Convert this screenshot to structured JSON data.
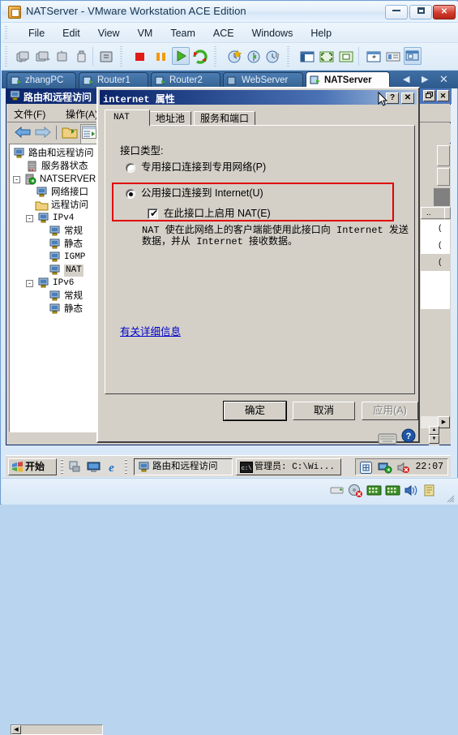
{
  "vmware": {
    "title": "NATServer - VMware Workstation ACE Edition",
    "window_buttons": {
      "minimize": "minimize-icon",
      "maximize": "maximize-icon",
      "close": "✕"
    },
    "menu": [
      "File",
      "Edit",
      "View",
      "VM",
      "Team",
      "ACE",
      "Windows",
      "Help"
    ],
    "toolbar_icons": [
      "power-on-snapshot-icon",
      "snapshot-manager-icon",
      "revert-snapshot-icon",
      "usb-device-icon",
      "summary-view-icon",
      "stop-icon",
      "pause-icon",
      "play-icon",
      "reset-icon",
      "take-snapshot-icon",
      "revert-icon",
      "manage-snapshots-icon",
      "show-sidebar-icon",
      "fullscreen-icon",
      "quick-switch-icon",
      "settings-icon",
      "console-view-icon",
      "multiple-monitors-icon"
    ],
    "tabs": [
      {
        "label": "zhangPC",
        "active": false
      },
      {
        "label": "Router1",
        "active": false
      },
      {
        "label": "Router2",
        "active": false
      },
      {
        "label": "WebServer",
        "active": false
      },
      {
        "label": "NATServer",
        "active": true
      }
    ],
    "tab_nav": {
      "prev": "◀",
      "next": "▶",
      "close": "✕"
    },
    "statusbar_icons": [
      "floppy-icon",
      "disk-icon",
      "network-icon-1",
      "network-icon-2",
      "sound-icon",
      "printer-icon"
    ]
  },
  "mmc": {
    "title": "路由和远程访问",
    "title_icon": "computer-icon",
    "window_buttons": [
      "restore-icon",
      "close-icon"
    ],
    "menu": [
      "文件(F)",
      "操作(A)"
    ],
    "toolbar_icons": [
      "back-arrow-icon",
      "forward-arrow-icon",
      "show-hide-console-tree-icon",
      "properties-icon"
    ],
    "tree": [
      {
        "label": "路由和远程访问",
        "indent": 0,
        "icon": "computer-icon",
        "expander": "",
        "selected": false
      },
      {
        "label": "服务器状态",
        "indent": 1,
        "icon": "server-icon",
        "expander": "",
        "selected": false
      },
      {
        "label": "NATSERVER",
        "indent": 1,
        "icon": "server-active-icon",
        "expander": "-",
        "selected": false
      },
      {
        "label": "网络接口",
        "indent": 2,
        "icon": "computer-icon",
        "expander": "",
        "selected": false
      },
      {
        "label": "远程访问",
        "indent": 2,
        "icon": "folder-icon",
        "expander": "",
        "selected": false
      },
      {
        "label": "IPv4",
        "indent": 2,
        "icon": "computer-icon",
        "expander": "-",
        "selected": false
      },
      {
        "label": "常规",
        "indent": 3,
        "icon": "computer-icon",
        "expander": "",
        "selected": false
      },
      {
        "label": "静态",
        "indent": 3,
        "icon": "computer-icon",
        "expander": "",
        "selected": false
      },
      {
        "label": "IGMP",
        "indent": 3,
        "icon": "computer-icon",
        "expander": "",
        "selected": false
      },
      {
        "label": "NAT",
        "indent": 3,
        "icon": "computer-icon",
        "expander": "",
        "selected": true
      },
      {
        "label": "IPv6",
        "indent": 2,
        "icon": "computer-icon",
        "expander": "-",
        "selected": false
      },
      {
        "label": "常规",
        "indent": 3,
        "icon": "computer-icon",
        "expander": "",
        "selected": false
      },
      {
        "label": "静态",
        "indent": 3,
        "icon": "computer-icon",
        "expander": "",
        "selected": false
      }
    ],
    "right_pane": {
      "column_header": "..",
      "rows": [
        "(",
        "(",
        "("
      ]
    }
  },
  "dialog": {
    "title": "internet 属性",
    "help_button": "?",
    "close_button": "✕",
    "tabs": [
      {
        "label": "NAT",
        "active": true
      },
      {
        "label": "地址池",
        "active": false
      },
      {
        "label": "服务和端口",
        "active": false
      }
    ],
    "interface_type_label": "接口类型:",
    "radio_private": {
      "label": "专用接口连接到专用网络(P)",
      "checked": false
    },
    "radio_public": {
      "label": "公用接口连接到 Internet(U)",
      "checked": true
    },
    "checkbox_nat": {
      "label": "在此接口上启用 NAT(E)",
      "checked": true,
      "mark": "✔"
    },
    "description_line1": "NAT 使在此网络上的客户端能使用此接口向 Internet 发送",
    "description_line2": "数据，并从 Internet 接收数据。",
    "more_info_link": "有关详细信息",
    "buttons": {
      "ok": "确定",
      "cancel": "取消",
      "apply": "应用(A)"
    },
    "highlight_color": "#e20000"
  },
  "taskbar": {
    "start": "开始",
    "quick_launch": [
      "show-desktop-icon",
      "desktop-icon",
      "internet-explorer-icon"
    ],
    "buttons": [
      {
        "label": "路由和远程访问",
        "icon": "mmc-icon",
        "active": true
      },
      {
        "label": "管理员: C:\\Wi...",
        "icon": "command-prompt-icon",
        "active": false
      }
    ],
    "tray_icons": [
      "vmware-tools-icon",
      "network-icon",
      "volume-muted-icon"
    ],
    "clock": "22:07"
  }
}
